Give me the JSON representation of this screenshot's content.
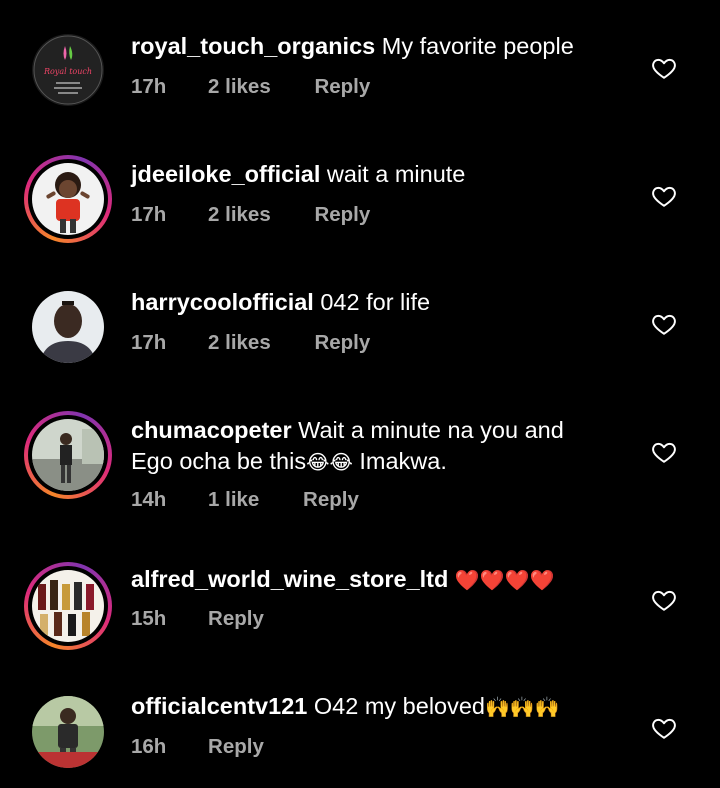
{
  "comments": [
    {
      "username": "royal_touch_organics",
      "text": "My favorite people",
      "time": "17h",
      "likes": "2 likes",
      "reply": "Reply",
      "avatar_text": "Royal touch"
    },
    {
      "username": "jdeeiloke_official",
      "text": "wait a minute",
      "time": "17h",
      "likes": "2 likes",
      "reply": "Reply"
    },
    {
      "username": "harrycoolofficial",
      "text": "042 for life",
      "time": "17h",
      "likes": "2 likes",
      "reply": "Reply"
    },
    {
      "username": "chumacopeter",
      "text_line1": "Wait a minute na you and",
      "text_line2a": "Ego ocha be this",
      "emoji1": "😂😂",
      "text_line2b": " Imakwa.",
      "time": "14h",
      "likes": "1 like",
      "reply": "Reply"
    },
    {
      "username": "alfred_world_wine_store_ltd",
      "text": "❤️❤️❤️❤️",
      "time": "15h",
      "reply": "Reply"
    },
    {
      "username": "officialcentv121",
      "text": "O42 my beloved",
      "emoji": "🙌🙌🙌",
      "time": "16h",
      "reply": "Reply"
    }
  ],
  "colors": {
    "background": "#000000",
    "meta_text": "#a8a8a8",
    "heart_red": "#e0242e"
  }
}
